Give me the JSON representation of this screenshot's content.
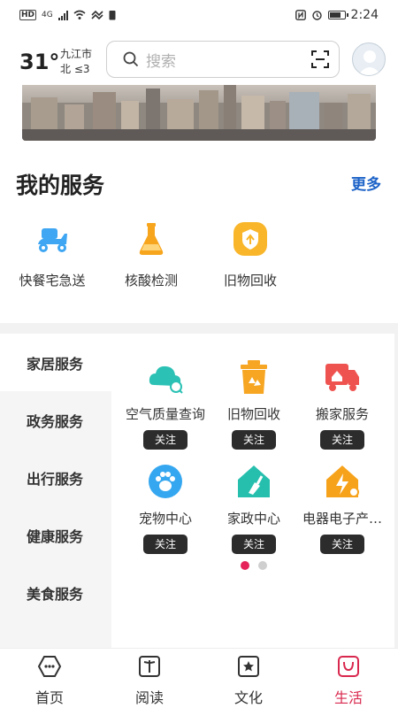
{
  "status_bar": {
    "time": "2:24",
    "hd": "HD",
    "network": "4G"
  },
  "header": {
    "temperature": "31°",
    "city": "九江市",
    "wind": "北 ≤3",
    "search_placeholder": "搜索"
  },
  "my_services": {
    "title": "我的服务",
    "more": "更多",
    "items": [
      {
        "label": "快餐宅急送",
        "icon": "scooter-icon",
        "color": "#3ea6f2"
      },
      {
        "label": "核酸检测",
        "icon": "flask-icon",
        "color": "#f7a51c"
      },
      {
        "label": "旧物回收",
        "icon": "recycle-badge-icon",
        "color": "#f9b62a"
      }
    ]
  },
  "categories": {
    "items": [
      {
        "label": "家居服务"
      },
      {
        "label": "政务服务"
      },
      {
        "label": "出行服务"
      },
      {
        "label": "健康服务"
      },
      {
        "label": "美食服务"
      }
    ]
  },
  "home_services": {
    "follow_label": "关注",
    "items": [
      {
        "label": "空气质量查询",
        "icon": "cloud-search-icon",
        "color": "#2bc1b4"
      },
      {
        "label": "旧物回收",
        "icon": "recycle-bin-icon",
        "color": "#f6a623"
      },
      {
        "label": "搬家服务",
        "icon": "moving-truck-icon",
        "color": "#ef5350"
      },
      {
        "label": "宠物中心",
        "icon": "paw-icon",
        "color": "#35a7f0"
      },
      {
        "label": "家政中心",
        "icon": "broom-house-icon",
        "color": "#26bfae"
      },
      {
        "label": "电器电子产…",
        "icon": "power-house-icon",
        "color": "#f7a21b"
      }
    ],
    "page_count": 2,
    "current_page": 1
  },
  "bottom_nav": {
    "items": [
      {
        "label": "首页",
        "icon": "home-icon"
      },
      {
        "label": "阅读",
        "icon": "book-icon"
      },
      {
        "label": "文化",
        "icon": "star-frame-icon"
      },
      {
        "label": "生活",
        "icon": "bag-icon"
      }
    ],
    "active": "生活",
    "active_color": "#d9284e"
  }
}
